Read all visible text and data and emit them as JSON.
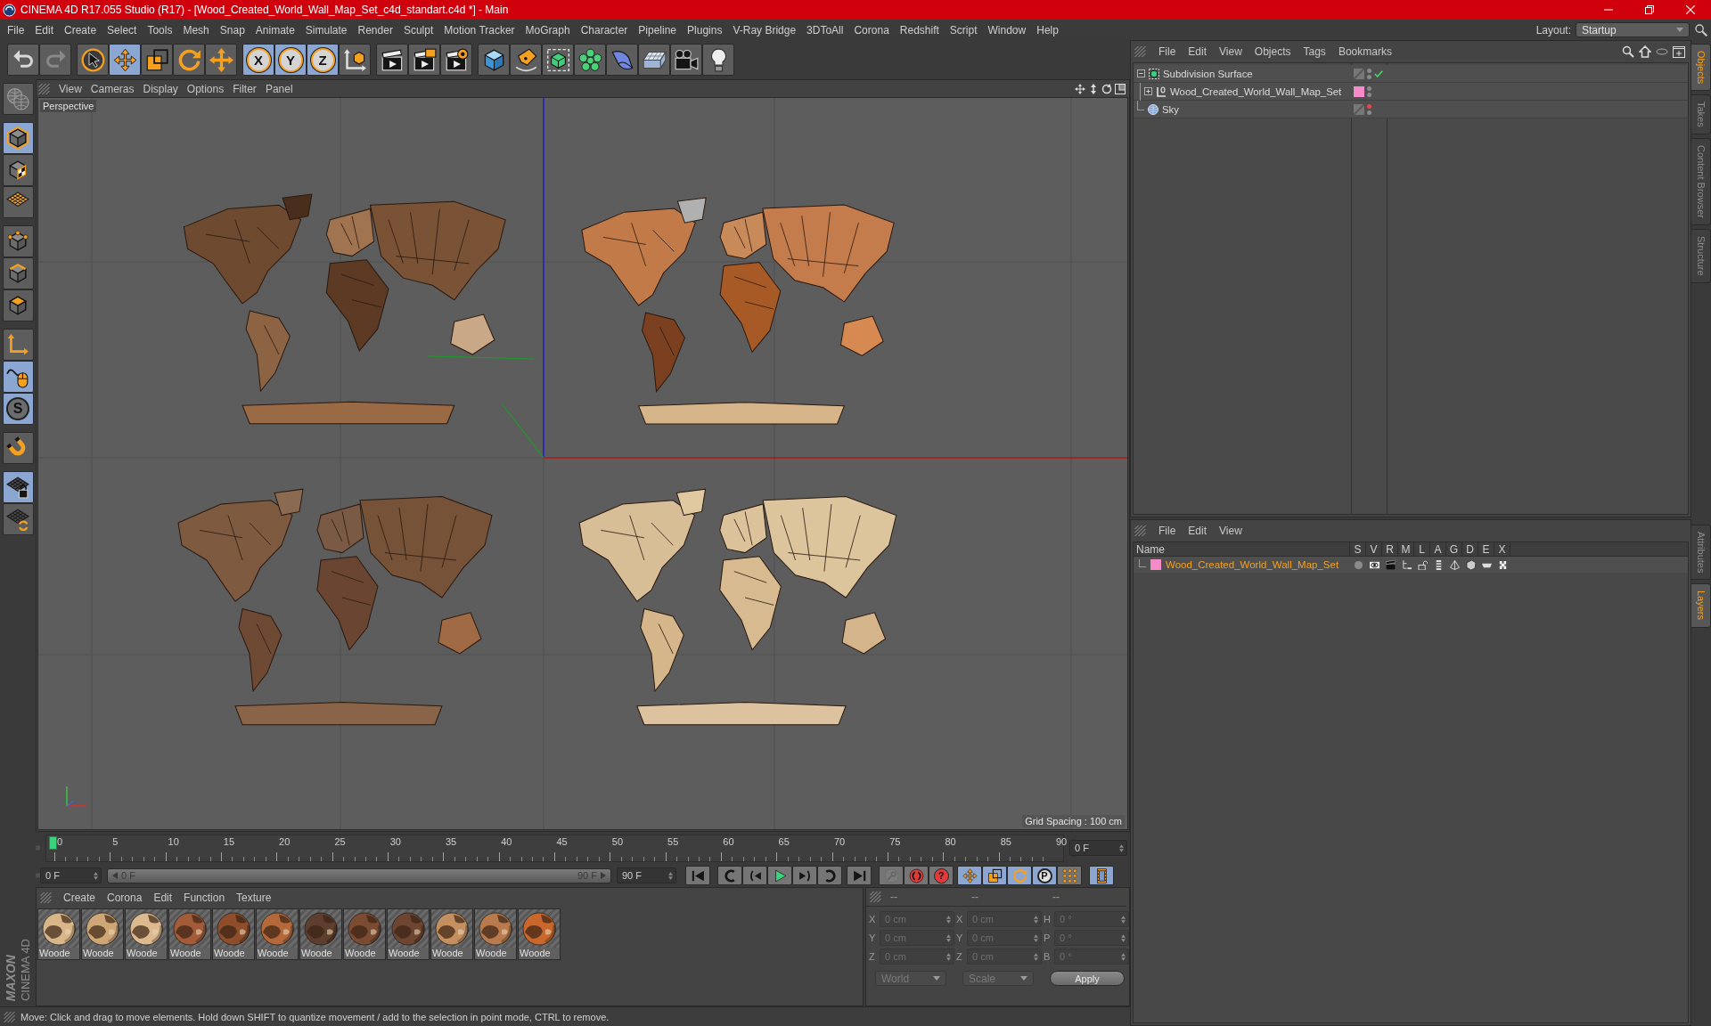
{
  "window": {
    "title": "CINEMA 4D R17.055 Studio (R17) - [Wood_Created_World_Wall_Map_Set_c4d_standart.c4d *] - Main"
  },
  "menu": [
    "File",
    "Edit",
    "Create",
    "Select",
    "Tools",
    "Mesh",
    "Snap",
    "Animate",
    "Simulate",
    "Render",
    "Sculpt",
    "Motion Tracker",
    "MoGraph",
    "Character",
    "Pipeline",
    "Plugins",
    "V-Ray Bridge",
    "3DToAll",
    "Corona",
    "Redshift",
    "Script",
    "Window",
    "Help"
  ],
  "layout": {
    "label": "Layout:",
    "value": "Startup"
  },
  "toolbar": [
    [
      {
        "kind": "undo",
        "disabled": false
      },
      {
        "kind": "redo",
        "disabled": true
      }
    ],
    [
      {
        "kind": "select",
        "selected": false
      },
      {
        "kind": "move",
        "selected": true
      },
      {
        "kind": "scale",
        "selected": false
      },
      {
        "kind": "rotate",
        "selected": false
      },
      {
        "kind": "transform",
        "selected": false
      }
    ],
    [
      {
        "kind": "axis",
        "label": "X",
        "selected": true
      },
      {
        "kind": "axis",
        "label": "Y",
        "selected": true
      },
      {
        "kind": "axis",
        "label": "Z",
        "selected": true
      },
      {
        "kind": "coords",
        "selected": false
      }
    ],
    [
      {
        "kind": "render-view"
      },
      {
        "kind": "render-region"
      },
      {
        "kind": "render-pv"
      }
    ],
    [
      {
        "kind": "cube"
      },
      {
        "kind": "pen"
      },
      {
        "kind": "subdivision"
      },
      {
        "kind": "cloner"
      },
      {
        "kind": "deformer"
      },
      {
        "kind": "floor"
      },
      {
        "kind": "camera"
      },
      {
        "kind": "light"
      }
    ]
  ],
  "palette": [
    [
      {
        "kind": "make-editable"
      }
    ],
    [
      {
        "kind": "model",
        "selected": true
      },
      {
        "kind": "texture",
        "selected": false
      },
      {
        "kind": "workplane",
        "selected": false
      }
    ],
    [
      {
        "kind": "points",
        "selected": false
      },
      {
        "kind": "edges",
        "selected": false
      },
      {
        "kind": "polygons",
        "selected": false
      }
    ],
    [
      {
        "kind": "axis-mode",
        "selected": false
      },
      {
        "kind": "tweak",
        "selected": true
      },
      {
        "kind": "snap",
        "label": "S",
        "selected": true
      }
    ],
    [
      {
        "kind": "magnet",
        "selected": false
      }
    ],
    [
      {
        "kind": "workplane-lock",
        "selected": true
      },
      {
        "kind": "grid-rotate",
        "selected": false
      }
    ]
  ],
  "logo": {
    "brand": "MAXON",
    "product": "CINEMA 4D"
  },
  "viewport": {
    "menu": [
      "View",
      "Cameras",
      "Display",
      "Options",
      "Filter",
      "Panel"
    ],
    "camera": "Perspective",
    "grid_spacing": "Grid Spacing : 100 cm"
  },
  "timeline": {
    "ticks": [
      "0",
      "5",
      "10",
      "15",
      "20",
      "25",
      "30",
      "35",
      "40",
      "45",
      "50",
      "55",
      "60",
      "65",
      "70",
      "75",
      "80",
      "85",
      "90"
    ],
    "level": 0,
    "frame": "0 F"
  },
  "transport": {
    "start": "0 F",
    "range_start": "0 F",
    "range_end": "90 F",
    "level": 1,
    "end": "90 F",
    "groups": [
      [
        {
          "kind": "to-start"
        }
      ],
      [
        {
          "kind": "prev-key"
        },
        {
          "kind": "prev-frame"
        },
        {
          "kind": "play"
        },
        {
          "kind": "next-frame"
        },
        {
          "kind": "next-key"
        }
      ],
      [
        {
          "kind": "to-end"
        }
      ],
      [
        {
          "kind": "record",
          "disabled": true
        },
        {
          "kind": "autokey",
          "disabled": false
        },
        {
          "kind": "keyinfo",
          "label": "?",
          "disabled": false
        }
      ],
      [
        {
          "kind": "key-move",
          "selected": true
        },
        {
          "kind": "key-scale",
          "selected": true
        },
        {
          "kind": "key-rotate",
          "selected": true
        },
        {
          "kind": "param",
          "label": "P",
          "selected": true
        },
        {
          "kind": "key-points",
          "selected": false
        }
      ],
      [
        {
          "kind": "timeline",
          "selected": true
        }
      ]
    ]
  },
  "materials": {
    "menu": [
      "Create",
      "Corona",
      "Edit",
      "Function",
      "Texture"
    ],
    "items": [
      {
        "name": "Woode",
        "color": "#d8b68a"
      },
      {
        "name": "Woode",
        "color": "#cfa776"
      },
      {
        "name": "Woode",
        "color": "#dcb98e"
      },
      {
        "name": "Woode",
        "color": "#a35c3a"
      },
      {
        "name": "Woode",
        "color": "#8e4e2c"
      },
      {
        "name": "Woode",
        "color": "#b5693a"
      },
      {
        "name": "Woode",
        "color": "#5e3e2c"
      },
      {
        "name": "Woode",
        "color": "#7c4c32"
      },
      {
        "name": "Woode",
        "color": "#6e4530"
      },
      {
        "name": "Woode",
        "color": "#c49060"
      },
      {
        "name": "Woode",
        "color": "#b97a4e"
      },
      {
        "name": "Woode",
        "color": "#c9672c"
      }
    ]
  },
  "coordinates": {
    "headers": [
      "--",
      "--",
      "--"
    ],
    "rows": [
      [
        {
          "label": "X",
          "value": "0 cm",
          "disabled": true
        },
        {
          "label": "X",
          "value": "0 cm",
          "disabled": true
        },
        {
          "label": "H",
          "value": "0 °",
          "disabled": true
        }
      ],
      [
        {
          "label": "Y",
          "value": "0 cm",
          "disabled": true
        },
        {
          "label": "Y",
          "value": "0 cm",
          "disabled": true
        },
        {
          "label": "P",
          "value": "0 °",
          "disabled": true
        }
      ],
      [
        {
          "label": "Z",
          "value": "0 cm",
          "disabled": true
        },
        {
          "label": "Z",
          "value": "0 cm",
          "disabled": true
        },
        {
          "label": "B",
          "value": "0 °",
          "disabled": true
        }
      ]
    ],
    "modes": [
      {
        "value": "World",
        "disabled": true
      },
      {
        "value": "Scale",
        "disabled": true
      }
    ],
    "apply": "Apply"
  },
  "status_bar": "Move: Click and drag to move elements. Hold down SHIFT to quantize movement / add to the selection in point mode, CTRL to remove.",
  "object_manager": {
    "menu": [
      "File",
      "Edit",
      "View",
      "Objects",
      "Tags",
      "Bookmarks"
    ],
    "objects": [
      {
        "name": "Subdivision Surface",
        "kind": "subdivision",
        "expanded": true,
        "enabled": true,
        "visible_in_editor": true,
        "visible_in_render": true,
        "children": [
          {
            "name": "Wood_Created_World_Wall_Map_Set",
            "kind": "null",
            "expanded": false,
            "color": "#f58ac8",
            "visible_in_editor": true,
            "visible_in_render": true
          }
        ]
      },
      {
        "name": "Sky",
        "kind": "sky",
        "visible_in_editor": false,
        "visible_in_render": true
      }
    ]
  },
  "layer_manager": {
    "menu": [
      "File",
      "Edit",
      "View"
    ],
    "columns": [
      "Name",
      "S",
      "V",
      "R",
      "M",
      "L",
      "A",
      "G",
      "D",
      "E",
      "X"
    ],
    "layers": [
      {
        "name": "Wood_Created_World_Wall_Map_Set",
        "color": "#f58ac8",
        "selected": true
      }
    ]
  },
  "side_tabs": {
    "upper": [
      {
        "label": "Objects",
        "selected": true
      },
      {
        "label": "Takes",
        "selected": false
      },
      {
        "label": "Content Browser",
        "selected": false
      },
      {
        "label": "Structure",
        "selected": false
      }
    ],
    "lower": [
      {
        "label": "Attributes",
        "selected": false
      },
      {
        "label": "Layers",
        "selected": true
      }
    ]
  }
}
